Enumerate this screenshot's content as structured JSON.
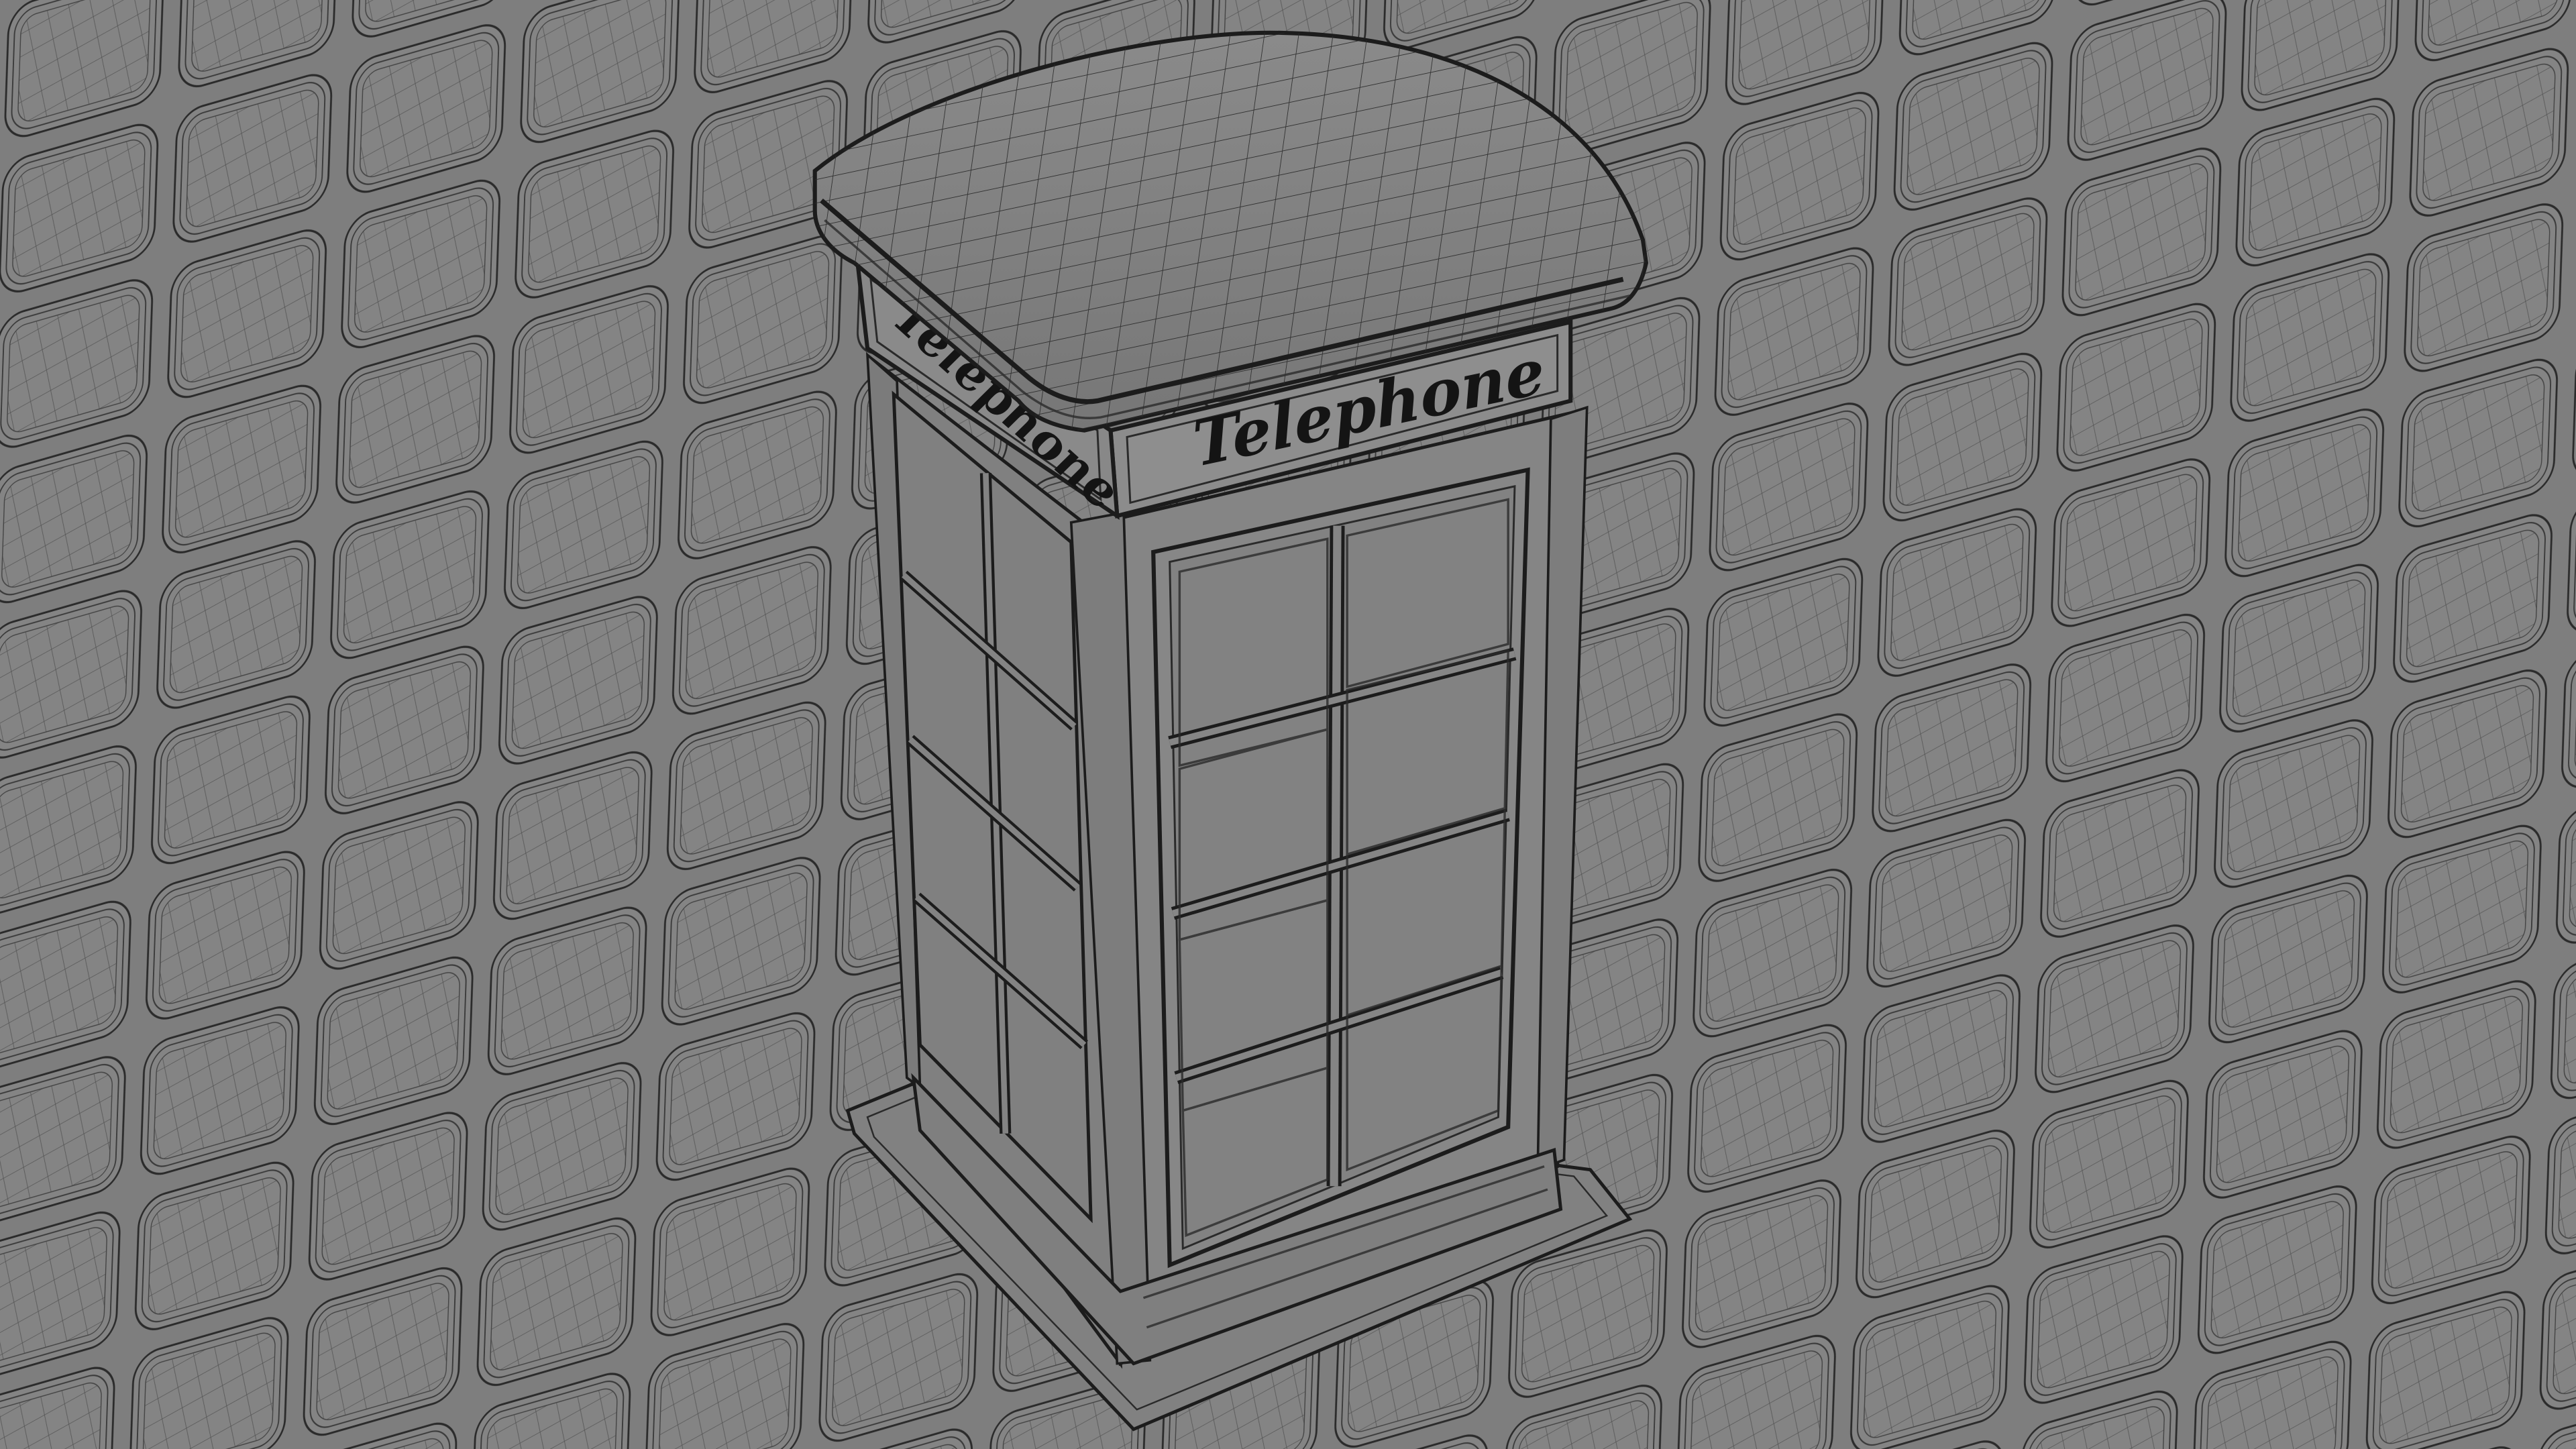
{
  "scene": {
    "object": "telephone-box",
    "ground": "cobblestone-paving",
    "shading": "wireframe-on-shaded",
    "colors": {
      "base": "#7c7c7c",
      "wire": "#2a2a2a",
      "edge": "#1c1c1c",
      "sign_text": "#141414"
    }
  },
  "signs": {
    "front": "Telephone",
    "side": "Telephone"
  }
}
